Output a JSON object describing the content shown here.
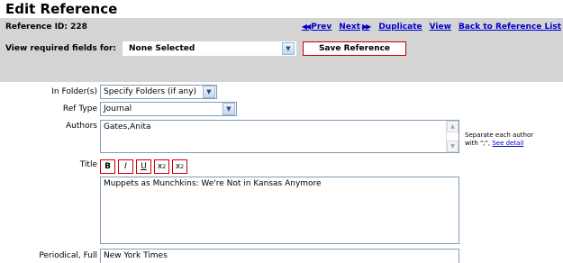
{
  "page": {
    "title": "Edit Reference",
    "reference_id": "Reference ID: 228"
  },
  "nav": {
    "prev_arrows": "◀◀",
    "prev": "Prev",
    "next": "Next",
    "next_arrows": "▶▶",
    "duplicate": "Duplicate",
    "view": "View",
    "back": "Back to Reference List"
  },
  "required": {
    "label": "View required fields for:",
    "selected": "None Selected",
    "save_label": "Save Reference"
  },
  "form": {
    "folder_label": "In Folder(s)",
    "folder_value": "Specify Folders (if any)",
    "reftype_label": "Ref Type",
    "reftype_value": "Journal",
    "authors_label": "Authors",
    "authors_value": "Gates,Anita",
    "authors_hint_line1": "Separate each author",
    "authors_hint_line2": "with \";\",",
    "authors_hint_link": "See detail",
    "title_label": "Title",
    "format_buttons": [
      "B",
      "I",
      "U",
      "x",
      "x"
    ],
    "title_value": "Muppets as Munchkins: We're Not in Kansas Anymore",
    "periodical_label": "Periodical, Full",
    "periodical_value": "New York Times"
  },
  "icons": {
    "dropdown": "▼",
    "scroll_up": "▲",
    "scroll_down": "▼"
  }
}
